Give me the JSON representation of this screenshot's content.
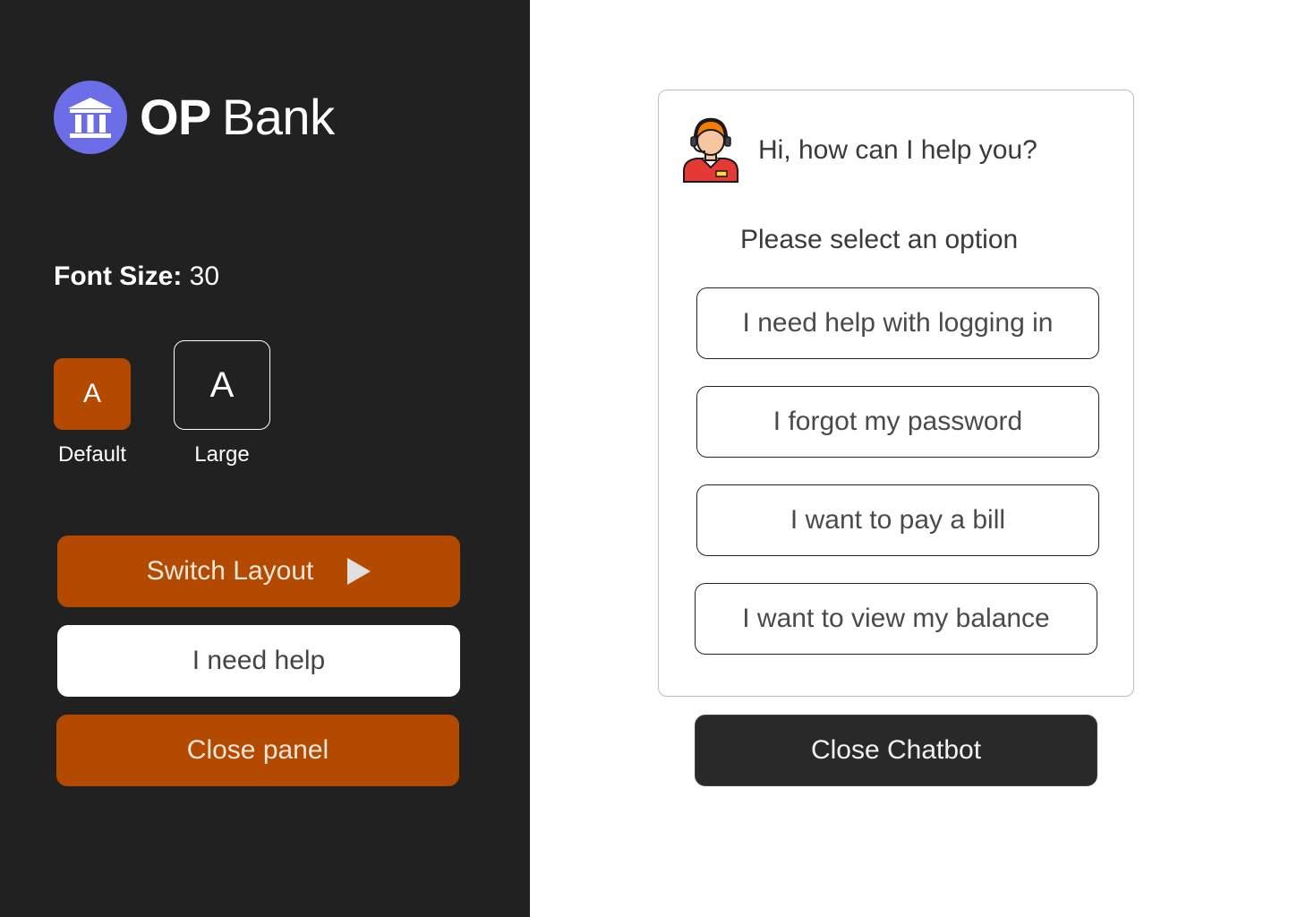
{
  "brand": {
    "name_bold": "OP",
    "name_regular": "Bank",
    "logo_icon": "bank-building-icon",
    "logo_color": "#6b6ee6"
  },
  "font_size": {
    "label": "Font Size:",
    "value": "30"
  },
  "size_options": [
    {
      "glyph": "A",
      "caption": "Default",
      "selected": true
    },
    {
      "glyph": "A",
      "caption": "Large",
      "selected": false
    }
  ],
  "panel_buttons": {
    "switch_layout": "Switch Layout",
    "switch_icon": "play-icon",
    "need_help": "I need help",
    "close_panel": "Close panel"
  },
  "chatbot": {
    "agent_icon": "support-agent-headset-icon",
    "greeting": "Hi, how can I help you?",
    "prompt": "Please select an option",
    "options": [
      "I need help with logging in",
      "I forgot my password",
      "I want to pay a bill",
      "I want to view my balance"
    ],
    "close_label": "Close Chatbot"
  },
  "colors": {
    "sidebar_bg": "#212121",
    "accent": "#b34a00",
    "dark_button": "#292929"
  }
}
